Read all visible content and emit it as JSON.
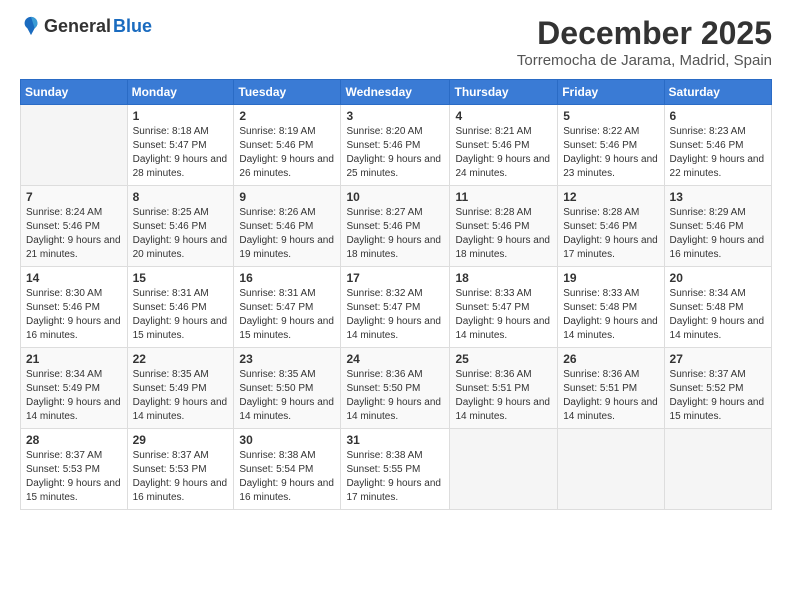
{
  "logo": {
    "general": "General",
    "blue": "Blue"
  },
  "header": {
    "title": "December 2025",
    "subtitle": "Torremocha de Jarama, Madrid, Spain"
  },
  "weekdays": [
    "Sunday",
    "Monday",
    "Tuesday",
    "Wednesday",
    "Thursday",
    "Friday",
    "Saturday"
  ],
  "weeks": [
    [
      {
        "day": "",
        "sunrise": "",
        "sunset": "",
        "daylight": ""
      },
      {
        "day": "1",
        "sunrise": "Sunrise: 8:18 AM",
        "sunset": "Sunset: 5:47 PM",
        "daylight": "Daylight: 9 hours and 28 minutes."
      },
      {
        "day": "2",
        "sunrise": "Sunrise: 8:19 AM",
        "sunset": "Sunset: 5:46 PM",
        "daylight": "Daylight: 9 hours and 26 minutes."
      },
      {
        "day": "3",
        "sunrise": "Sunrise: 8:20 AM",
        "sunset": "Sunset: 5:46 PM",
        "daylight": "Daylight: 9 hours and 25 minutes."
      },
      {
        "day": "4",
        "sunrise": "Sunrise: 8:21 AM",
        "sunset": "Sunset: 5:46 PM",
        "daylight": "Daylight: 9 hours and 24 minutes."
      },
      {
        "day": "5",
        "sunrise": "Sunrise: 8:22 AM",
        "sunset": "Sunset: 5:46 PM",
        "daylight": "Daylight: 9 hours and 23 minutes."
      },
      {
        "day": "6",
        "sunrise": "Sunrise: 8:23 AM",
        "sunset": "Sunset: 5:46 PM",
        "daylight": "Daylight: 9 hours and 22 minutes."
      }
    ],
    [
      {
        "day": "7",
        "sunrise": "Sunrise: 8:24 AM",
        "sunset": "Sunset: 5:46 PM",
        "daylight": "Daylight: 9 hours and 21 minutes."
      },
      {
        "day": "8",
        "sunrise": "Sunrise: 8:25 AM",
        "sunset": "Sunset: 5:46 PM",
        "daylight": "Daylight: 9 hours and 20 minutes."
      },
      {
        "day": "9",
        "sunrise": "Sunrise: 8:26 AM",
        "sunset": "Sunset: 5:46 PM",
        "daylight": "Daylight: 9 hours and 19 minutes."
      },
      {
        "day": "10",
        "sunrise": "Sunrise: 8:27 AM",
        "sunset": "Sunset: 5:46 PM",
        "daylight": "Daylight: 9 hours and 18 minutes."
      },
      {
        "day": "11",
        "sunrise": "Sunrise: 8:28 AM",
        "sunset": "Sunset: 5:46 PM",
        "daylight": "Daylight: 9 hours and 18 minutes."
      },
      {
        "day": "12",
        "sunrise": "Sunrise: 8:28 AM",
        "sunset": "Sunset: 5:46 PM",
        "daylight": "Daylight: 9 hours and 17 minutes."
      },
      {
        "day": "13",
        "sunrise": "Sunrise: 8:29 AM",
        "sunset": "Sunset: 5:46 PM",
        "daylight": "Daylight: 9 hours and 16 minutes."
      }
    ],
    [
      {
        "day": "14",
        "sunrise": "Sunrise: 8:30 AM",
        "sunset": "Sunset: 5:46 PM",
        "daylight": "Daylight: 9 hours and 16 minutes."
      },
      {
        "day": "15",
        "sunrise": "Sunrise: 8:31 AM",
        "sunset": "Sunset: 5:46 PM",
        "daylight": "Daylight: 9 hours and 15 minutes."
      },
      {
        "day": "16",
        "sunrise": "Sunrise: 8:31 AM",
        "sunset": "Sunset: 5:47 PM",
        "daylight": "Daylight: 9 hours and 15 minutes."
      },
      {
        "day": "17",
        "sunrise": "Sunrise: 8:32 AM",
        "sunset": "Sunset: 5:47 PM",
        "daylight": "Daylight: 9 hours and 14 minutes."
      },
      {
        "day": "18",
        "sunrise": "Sunrise: 8:33 AM",
        "sunset": "Sunset: 5:47 PM",
        "daylight": "Daylight: 9 hours and 14 minutes."
      },
      {
        "day": "19",
        "sunrise": "Sunrise: 8:33 AM",
        "sunset": "Sunset: 5:48 PM",
        "daylight": "Daylight: 9 hours and 14 minutes."
      },
      {
        "day": "20",
        "sunrise": "Sunrise: 8:34 AM",
        "sunset": "Sunset: 5:48 PM",
        "daylight": "Daylight: 9 hours and 14 minutes."
      }
    ],
    [
      {
        "day": "21",
        "sunrise": "Sunrise: 8:34 AM",
        "sunset": "Sunset: 5:49 PM",
        "daylight": "Daylight: 9 hours and 14 minutes."
      },
      {
        "day": "22",
        "sunrise": "Sunrise: 8:35 AM",
        "sunset": "Sunset: 5:49 PM",
        "daylight": "Daylight: 9 hours and 14 minutes."
      },
      {
        "day": "23",
        "sunrise": "Sunrise: 8:35 AM",
        "sunset": "Sunset: 5:50 PM",
        "daylight": "Daylight: 9 hours and 14 minutes."
      },
      {
        "day": "24",
        "sunrise": "Sunrise: 8:36 AM",
        "sunset": "Sunset: 5:50 PM",
        "daylight": "Daylight: 9 hours and 14 minutes."
      },
      {
        "day": "25",
        "sunrise": "Sunrise: 8:36 AM",
        "sunset": "Sunset: 5:51 PM",
        "daylight": "Daylight: 9 hours and 14 minutes."
      },
      {
        "day": "26",
        "sunrise": "Sunrise: 8:36 AM",
        "sunset": "Sunset: 5:51 PM",
        "daylight": "Daylight: 9 hours and 14 minutes."
      },
      {
        "day": "27",
        "sunrise": "Sunrise: 8:37 AM",
        "sunset": "Sunset: 5:52 PM",
        "daylight": "Daylight: 9 hours and 15 minutes."
      }
    ],
    [
      {
        "day": "28",
        "sunrise": "Sunrise: 8:37 AM",
        "sunset": "Sunset: 5:53 PM",
        "daylight": "Daylight: 9 hours and 15 minutes."
      },
      {
        "day": "29",
        "sunrise": "Sunrise: 8:37 AM",
        "sunset": "Sunset: 5:53 PM",
        "daylight": "Daylight: 9 hours and 16 minutes."
      },
      {
        "day": "30",
        "sunrise": "Sunrise: 8:38 AM",
        "sunset": "Sunset: 5:54 PM",
        "daylight": "Daylight: 9 hours and 16 minutes."
      },
      {
        "day": "31",
        "sunrise": "Sunrise: 8:38 AM",
        "sunset": "Sunset: 5:55 PM",
        "daylight": "Daylight: 9 hours and 17 minutes."
      },
      {
        "day": "",
        "sunrise": "",
        "sunset": "",
        "daylight": ""
      },
      {
        "day": "",
        "sunrise": "",
        "sunset": "",
        "daylight": ""
      },
      {
        "day": "",
        "sunrise": "",
        "sunset": "",
        "daylight": ""
      }
    ]
  ]
}
